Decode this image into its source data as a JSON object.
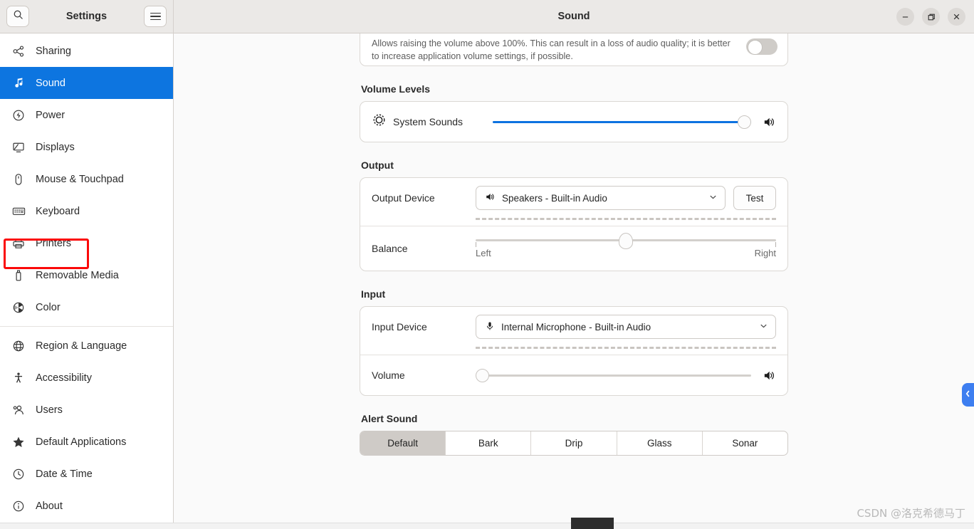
{
  "window": {
    "sidebar_title": "Settings",
    "main_title": "Sound",
    "search_icon": "search-icon",
    "menu_icon": "hamburger-icon",
    "minimize_label": "–",
    "maximize_label": "❐",
    "close_label": "✕"
  },
  "sidebar": {
    "items": [
      {
        "label": "Sharing",
        "icon": "share-icon",
        "active": false
      },
      {
        "label": "Sound",
        "icon": "music-note-icon",
        "active": true
      },
      {
        "label": "Power",
        "icon": "power-icon",
        "active": false
      },
      {
        "label": "Displays",
        "icon": "display-icon",
        "active": false
      },
      {
        "label": "Mouse & Touchpad",
        "icon": "mouse-icon",
        "active": false
      },
      {
        "label": "Keyboard",
        "icon": "keyboard-icon",
        "active": false
      },
      {
        "label": "Printers",
        "icon": "printer-icon",
        "active": false
      },
      {
        "label": "Removable Media",
        "icon": "usb-drive-icon",
        "active": false
      },
      {
        "label": "Color",
        "icon": "color-wheel-icon",
        "active": false
      },
      {
        "label": "Region & Language",
        "icon": "globe-icon",
        "active": false
      },
      {
        "label": "Accessibility",
        "icon": "accessibility-icon",
        "active": false
      },
      {
        "label": "Users",
        "icon": "users-icon",
        "active": false
      },
      {
        "label": "Default Applications",
        "icon": "star-icon",
        "active": false
      },
      {
        "label": "Date & Time",
        "icon": "clock-icon",
        "active": false
      },
      {
        "label": "About",
        "icon": "info-icon",
        "active": false
      }
    ],
    "highlight": {
      "target": "Printers",
      "color": "#fb0909"
    }
  },
  "main": {
    "overamplification": {
      "description": "Allows raising the volume above 100%. This can result in a loss of audio quality; it is better to increase application volume settings, if possible.",
      "toggle_on": false
    },
    "volume_levels": {
      "title": "Volume Levels",
      "rows": [
        {
          "label": "System Sounds",
          "icon": "system-sounds-icon",
          "value_percent": 100,
          "speaker_icon": "volume-high-icon"
        }
      ]
    },
    "output": {
      "title": "Output",
      "device_label": "Output Device",
      "device_value": "Speakers - Built-in Audio",
      "device_icon": "speaker-icon",
      "dropdown_icon": "chevron-down-icon",
      "test_label": "Test",
      "balance_label": "Balance",
      "balance_left": "Left",
      "balance_right": "Right",
      "balance_percent": 50
    },
    "input": {
      "title": "Input",
      "device_label": "Input Device",
      "device_value": "Internal Microphone - Built-in Audio",
      "device_icon": "microphone-icon",
      "dropdown_icon": "chevron-down-icon",
      "volume_label": "Volume",
      "volume_percent": 2,
      "speaker_icon": "volume-high-icon"
    },
    "alert_sound": {
      "title": "Alert Sound",
      "options": [
        "Default",
        "Bark",
        "Drip",
        "Glass",
        "Sonar"
      ],
      "selected": "Default"
    }
  },
  "overlay": {
    "edge_tab_icon": "chevron-left-icon",
    "watermark": "CSDN @洛克希德马丁",
    "accent_blue": "#0d75e0",
    "tab_blue": "#3d7ef0"
  }
}
